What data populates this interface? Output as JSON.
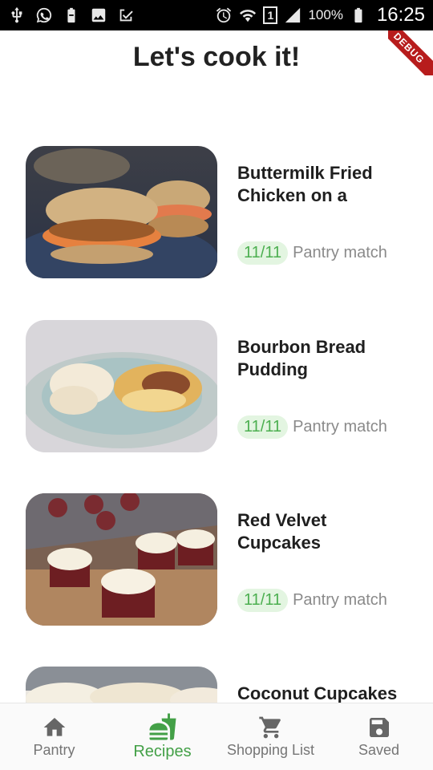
{
  "status_bar": {
    "battery_percent": "100%",
    "time": "16:25",
    "sim_label": "1",
    "icons": [
      "usb-icon",
      "whatsapp-icon",
      "battery-saver-icon",
      "image-icon",
      "check-icon",
      "alarm-icon",
      "wifi-icon",
      "sim-icon",
      "signal-icon",
      "battery-icon"
    ]
  },
  "debug_banner": "DEBUG",
  "header": {
    "title": "Let's cook it!"
  },
  "recipes": [
    {
      "title": "Buttermilk Fried Chicken on a",
      "match": "11/11",
      "match_label": "Pantry match"
    },
    {
      "title": "Bourbon Bread Pudding",
      "match": "11/11",
      "match_label": "Pantry match"
    },
    {
      "title": "Red Velvet Cupcakes",
      "match": "11/11",
      "match_label": "Pantry match"
    },
    {
      "title": "Coconut Cupcakes",
      "match": "",
      "match_label": ""
    }
  ],
  "bottom_nav": {
    "items": [
      {
        "label": "Pantry",
        "icon": "home-icon",
        "active": false
      },
      {
        "label": "Recipes",
        "icon": "fastfood-icon",
        "active": true
      },
      {
        "label": "Shopping List",
        "icon": "cart-icon",
        "active": false
      },
      {
        "label": "Saved",
        "icon": "save-icon",
        "active": false
      }
    ]
  },
  "colors": {
    "accent": "#43a047",
    "badge_bg": "#e3f5e1",
    "debug": "#b71c1c"
  }
}
